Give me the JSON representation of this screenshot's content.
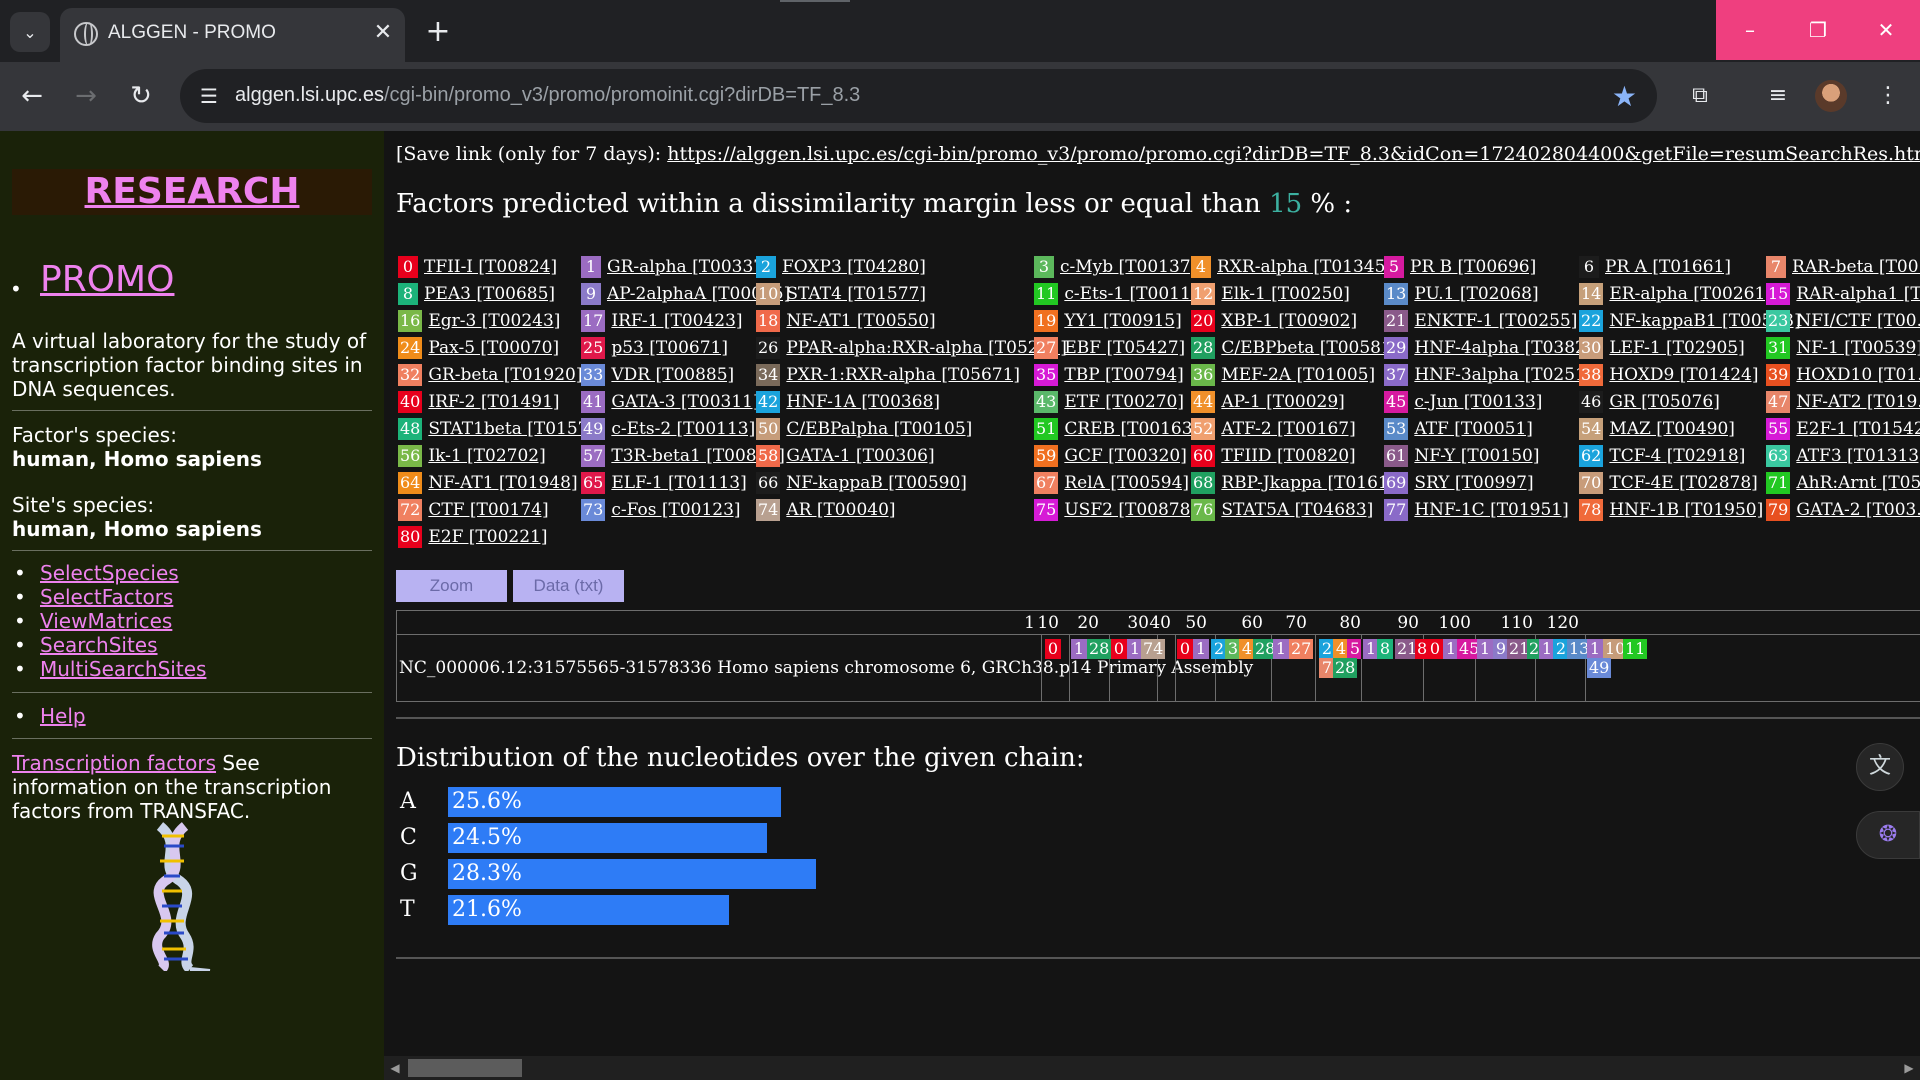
{
  "browser": {
    "tab_title": "ALGGEN - PROMO",
    "url_host": "alggen.lsi.upc.es",
    "url_path": "/cgi-bin/promo_v3/promo/promoinit.cgi?dirDB=TF_8.3",
    "icons": {
      "tab_search": "chevron-down-icon",
      "close": "close-icon",
      "new_tab": "plus-icon",
      "back": "back-arrow-icon",
      "forward": "forward-arrow-icon",
      "reload": "reload-icon",
      "site_info": "tune-icon",
      "bookmark": "star-icon",
      "extensions": "puzzle-icon",
      "media": "media-control-icon",
      "menu": "kebab-menu-icon"
    },
    "window_controls": {
      "minimize": "–",
      "restore": "❐",
      "close": "✕"
    },
    "window_color": "#ef3f7f"
  },
  "sidebar": {
    "research": "RESEARCH",
    "promo": "PROMO",
    "description": "A virtual laboratory for the study of transcription factor binding sites in DNA sequences.",
    "factor_species_label": "Factor's species:",
    "factor_species_value": "human, Homo sapiens",
    "site_species_label": "Site's species:",
    "site_species_value": "human, Homo sapiens",
    "links": [
      "SelectSpecies",
      "SelectFactors",
      "ViewMatrices",
      "SearchSites",
      "MultiSearchSites"
    ],
    "help": "Help",
    "tf_link": "Transcription factors",
    "tf_text": " See information on the transcription factors from TRANSFAC.",
    "link_color": "#ee82ee"
  },
  "main": {
    "save_prefix": "[Save link (only for 7 days): ",
    "save_url": "https://alggen.lsi.upc.es/cgi-bin/promo_v3/promo/promo.cgi?dirDB=TF_8.3&idCon=172402804400&getFile=resumSearchRes.html",
    "save_suffix": "]",
    "heading_prefix": "Factors predicted within a dissimilarity margin less or equal than ",
    "heading_pct": "15",
    "heading_suffix": " % :",
    "factors": [
      [
        "0",
        "TFII-I [T00824]",
        "#e8001c"
      ],
      [
        "1",
        "GR-alpha [T00337]",
        "#9b6cc2"
      ],
      [
        "2",
        "FOXP3 [T04280]",
        "#1aa3dc"
      ],
      [
        "3",
        "c-Myb [T00137]",
        "#5cb85c"
      ],
      [
        "4",
        "RXR-alpha [T01345]",
        "#f0902a"
      ],
      [
        "5",
        "PR B [T00696]",
        "#d61aa0"
      ],
      [
        "6",
        "PR A [T01661]",
        "#1c1c1c"
      ],
      [
        "7",
        "RAR-beta [T00...",
        "#e8866a"
      ],
      [
        "8",
        "PEA3 [T00685]",
        "#1cb37a"
      ],
      [
        "9",
        "AP-2alphaA [T00035]",
        "#8b7ac8"
      ],
      [
        "10",
        "STAT4 [T01577]",
        "#c69c7a"
      ],
      [
        "11",
        "c-Ets-1 [T00112]",
        "#22c822"
      ],
      [
        "12",
        "Elk-1 [T00250]",
        "#f0a070"
      ],
      [
        "13",
        "PU.1 [T02068]",
        "#5a8ac8"
      ],
      [
        "14",
        "ER-alpha [T00261]",
        "#c6a07a"
      ],
      [
        "15",
        "RAR-alpha1 [T...",
        "#d61ad6"
      ],
      [
        "16",
        "Egr-3 [T00243]",
        "#7ab848"
      ],
      [
        "17",
        "IRF-1 [T00423]",
        "#9b6cc2"
      ],
      [
        "18",
        "NF-AT1 [T00550]",
        "#f06a4a"
      ],
      [
        "19",
        "YY1 [T00915]",
        "#f07020"
      ],
      [
        "20",
        "XBP-1 [T00902]",
        "#e8001c"
      ],
      [
        "21",
        "ENKTF-1 [T00255]",
        "#8a5a8a"
      ],
      [
        "22",
        "NF-kappaB1 [T00593]",
        "#1aa3dc"
      ],
      [
        "23",
        "NFI/CTF [T00...",
        "#3ac8a0"
      ],
      [
        "24",
        "Pax-5 [T00070]",
        "#f08c1a"
      ],
      [
        "25",
        "p53 [T00671]",
        "#e0184a"
      ],
      [
        "26",
        "PPAR-alpha:RXR-alpha [T05221]",
        "#1c1c1c"
      ],
      [
        "27",
        "EBF [T05427]",
        "#f08060"
      ],
      [
        "28",
        "C/EBPbeta [T00581]",
        "#20a060"
      ],
      [
        "29",
        "HNF-4alpha [T03828]",
        "#8a6ac8"
      ],
      [
        "30",
        "LEF-1 [T02905]",
        "#c89c7a"
      ],
      [
        "31",
        "NF-1 [T00539]",
        "#22c822"
      ],
      [
        "32",
        "GR-beta [T01920]",
        "#f08060"
      ],
      [
        "33",
        "VDR [T00885]",
        "#6a8ad8"
      ],
      [
        "34",
        "PXR-1:RXR-alpha [T05671]",
        "#7a6a5a"
      ],
      [
        "35",
        "TBP [T00794]",
        "#d61ad6"
      ],
      [
        "36",
        "MEF-2A [T01005]",
        "#6ab84a"
      ],
      [
        "37",
        "HNF-3alpha [T02512]",
        "#8a6ac8"
      ],
      [
        "38",
        "HOXD9 [T01424]",
        "#f06a3a"
      ],
      [
        "39",
        "HOXD10 [T01...",
        "#e85020"
      ],
      [
        "40",
        "IRF-2 [T01491]",
        "#e8001c"
      ],
      [
        "41",
        "GATA-3 [T00311]",
        "#9b6cc2"
      ],
      [
        "42",
        "HNF-1A [T00368]",
        "#1aa3dc"
      ],
      [
        "43",
        "ETF [T00270]",
        "#5ab86a"
      ],
      [
        "44",
        "AP-1 [T00029]",
        "#f0902a"
      ],
      [
        "45",
        "c-Jun [T00133]",
        "#d61aa0"
      ],
      [
        "46",
        "GR [T05076]",
        "#1c1c1c"
      ],
      [
        "47",
        "NF-AT2 [T019...",
        "#e8866a"
      ],
      [
        "48",
        "STAT1beta [T01573]",
        "#1cb37a"
      ],
      [
        "49",
        "c-Ets-2 [T00113]",
        "#8b7ac8"
      ],
      [
        "50",
        "C/EBPalpha [T00105]",
        "#c69c7a"
      ],
      [
        "51",
        "CREB [T00163]",
        "#22c822"
      ],
      [
        "52",
        "ATF-2 [T00167]",
        "#f0a070"
      ],
      [
        "53",
        "ATF [T00051]",
        "#5a8ac8"
      ],
      [
        "54",
        "MAZ [T00490]",
        "#c6a07a"
      ],
      [
        "55",
        "E2F-1 [T01542]",
        "#d61ad6"
      ],
      [
        "56",
        "Ik-1 [T02702]",
        "#7ab848"
      ],
      [
        "57",
        "T3R-beta1 [T00851]",
        "#9b6cc2"
      ],
      [
        "58",
        "GATA-1 [T00306]",
        "#f06a4a"
      ],
      [
        "59",
        "GCF [T00320]",
        "#f07020"
      ],
      [
        "60",
        "TFIID [T00820]",
        "#e8001c"
      ],
      [
        "61",
        "NF-Y [T00150]",
        "#8a5a8a"
      ],
      [
        "62",
        "TCF-4 [T02918]",
        "#1aa3dc"
      ],
      [
        "63",
        "ATF3 [T01313]",
        "#3ac8a0"
      ],
      [
        "64",
        "NF-AT1 [T01948]",
        "#f08c1a"
      ],
      [
        "65",
        "ELF-1 [T01113]",
        "#e0184a"
      ],
      [
        "66",
        "NF-kappaB [T00590]",
        "#1c1c1c"
      ],
      [
        "67",
        "RelA [T00594]",
        "#f08060"
      ],
      [
        "68",
        "RBP-Jkappa [T01616]",
        "#20a060"
      ],
      [
        "69",
        "SRY [T00997]",
        "#8a6ac8"
      ],
      [
        "70",
        "TCF-4E [T02878]",
        "#c89c7a"
      ],
      [
        "71",
        "AhR:Arnt [T05...",
        "#22c822"
      ],
      [
        "72",
        "CTF [T00174]",
        "#f08060"
      ],
      [
        "73",
        "c-Fos [T00123]",
        "#6a8ad8"
      ],
      [
        "74",
        "AR [T00040]",
        "#b8a090"
      ],
      [
        "75",
        "USF2 [T00878]",
        "#d61ad6"
      ],
      [
        "76",
        "STAT5A [T04683]",
        "#6ab84a"
      ],
      [
        "77",
        "HNF-1C [T01951]",
        "#8a6ac8"
      ],
      [
        "78",
        "HNF-1B [T01950]",
        "#f06a3a"
      ],
      [
        "79",
        "GATA-2 [T003...",
        "#e85020"
      ],
      [
        "80",
        "E2F [T00221]",
        "#e8001c"
      ]
    ],
    "zoom_btn": "Zoom",
    "data_btn": "Data (txt)",
    "ticks": [
      "1",
      "10",
      "20",
      "30",
      "40",
      "50",
      "60",
      "70",
      "80",
      "90",
      "100",
      "110",
      "120"
    ],
    "seq_name": "NC_000006.12:31575565-31578336 Homo sapiens chromosome 6, GRCh38.p14 Primary Assembly",
    "markers": [
      [
        "0",
        "#e8001c"
      ],
      [
        "1",
        "#9b6cc2"
      ],
      [
        "28",
        "#20a060"
      ],
      [
        "0",
        "#e8001c"
      ],
      [
        "1",
        "#9b6cc2"
      ],
      [
        "74",
        "#b8a090"
      ],
      [
        "0",
        "#e8001c"
      ],
      [
        "1",
        "#9b6cc2"
      ],
      [
        "2",
        "#1aa3dc"
      ],
      [
        "3",
        "#5cb85c"
      ],
      [
        "4",
        "#f0902a"
      ],
      [
        "28",
        "#20a060"
      ],
      [
        "1",
        "#9b6cc2"
      ],
      [
        "27",
        "#f08060"
      ],
      [
        "2",
        "#1aa3dc"
      ],
      [
        "4",
        "#f0902a"
      ],
      [
        "5",
        "#d61aa0"
      ],
      [
        "6",
        "#1c1c1c"
      ],
      [
        "7",
        "#e8866a"
      ],
      [
        "28",
        "#20a060"
      ],
      [
        "1",
        "#9b6cc2"
      ],
      [
        "8",
        "#1cb37a"
      ],
      [
        "21",
        "#8a5a8a"
      ],
      [
        "80",
        "#e8001c"
      ],
      [
        "0",
        "#e8001c"
      ],
      [
        "1",
        "#9b6cc2"
      ],
      [
        "45",
        "#d61aa0"
      ],
      [
        "1",
        "#9b6cc2"
      ],
      [
        "9",
        "#8b7ac8"
      ],
      [
        "21",
        "#8a5a8a"
      ],
      [
        "28",
        "#20a060"
      ],
      [
        "1",
        "#9b6cc2"
      ],
      [
        "2",
        "#1aa3dc"
      ],
      [
        "13",
        "#5a8ac8"
      ],
      [
        "1",
        "#9b6cc2"
      ],
      [
        "10",
        "#c69c7a"
      ],
      [
        "11",
        "#22c822"
      ],
      [
        "49",
        "#6a8ad8"
      ]
    ],
    "distrib_title": "Distribution of the nucleotides over the given chain:",
    "distribution": [
      {
        "base": "A",
        "label": "25.6%",
        "value": 25.6
      },
      {
        "base": "C",
        "label": "24.5%",
        "value": 24.5
      },
      {
        "base": "G",
        "label": "28.3%",
        "value": 28.3
      },
      {
        "base": "T",
        "label": "21.6%",
        "value": 21.6
      }
    ],
    "side_icons": [
      "translate-icon",
      "brain-icon"
    ]
  }
}
